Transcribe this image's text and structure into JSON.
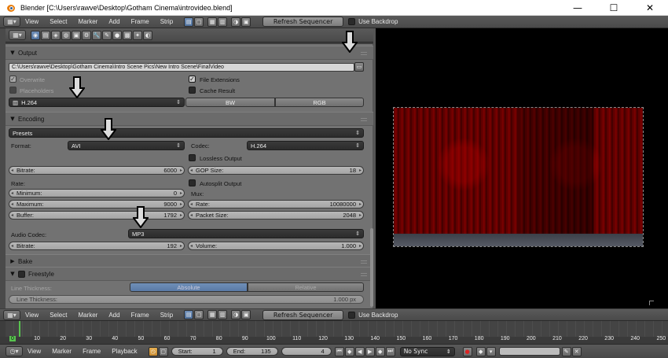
{
  "window": {
    "title": "Blender [C:\\Users\\rawve\\Desktop\\Gotham Cinema\\introvideo.blend]",
    "minimize": "—",
    "maximize": "☐",
    "close": "✕"
  },
  "header": {
    "menus": [
      "View",
      "Select",
      "Marker",
      "Add",
      "Frame",
      "Strip"
    ],
    "refresh_label": "Refresh Sequencer",
    "backdrop_label": "Use Backdrop"
  },
  "output": {
    "section_label": "Output",
    "path": "C:\\Users\\rawve\\Desktop\\Gotham Cinema\\Intro Scene Pics\\New Intro Scene\\FinalVideo",
    "overwrite_label": "Overwrite",
    "placeholders_label": "Placeholders",
    "file_extensions_label": "File Extensions",
    "cache_result_label": "Cache Result",
    "file_format": "H.264",
    "color_bw": "BW",
    "color_rgb": "RGB"
  },
  "encoding": {
    "section_label": "Encoding",
    "presets_label": "Presets",
    "format_label": "Format:",
    "format_value": "AVI",
    "codec_label": "Codec:",
    "codec_value": "H.264",
    "lossless_label": "Lossless Output",
    "bitrate_label": "Bitrate:",
    "bitrate_value": "6000",
    "gop_label": "GOP Size:",
    "gop_value": "18",
    "rate_label": "Rate:",
    "autosplit_label": "Autosplit Output",
    "minimum_label": "Minimum:",
    "minimum_value": "0",
    "mux_label": "Mux:",
    "maximum_label": "Maximum:",
    "maximum_value": "9000",
    "mux_rate_label": "Rate:",
    "mux_rate_value": "10080000",
    "buffer_label": "Buffer:",
    "buffer_value": "1792",
    "packet_label": "Packet Size:",
    "packet_value": "2048",
    "audio_codec_label": "Audio Codec:",
    "audio_codec_value": "MP3",
    "audio_bitrate_label": "Bitrate:",
    "audio_bitrate_value": "192",
    "volume_label": "Volume:",
    "volume_value": "1.000"
  },
  "bake": {
    "section_label": "Bake"
  },
  "freestyle": {
    "section_label": "Freestyle",
    "line_thickness_label": "Line Thickness:",
    "absolute_label": "Absolute",
    "relative_label": "Relative",
    "line_thickness_value_label": "Line Thickness:",
    "line_thickness_value": "1.000 px"
  },
  "timeline": {
    "ticks": [
      "0",
      "10",
      "20",
      "30",
      "40",
      "50",
      "60",
      "70",
      "80",
      "90",
      "100",
      "110",
      "120",
      "130",
      "140",
      "150",
      "160",
      "170",
      "180",
      "190",
      "200",
      "210",
      "220",
      "230",
      "240",
      "250"
    ],
    "current_frame": "0"
  },
  "statusbar": {
    "menus": [
      "View",
      "Marker",
      "Frame",
      "Playback"
    ],
    "start_label": "Start:",
    "start_value": "1",
    "end_label": "End:",
    "end_value": "135",
    "frame_value": "4",
    "sync_value": "No Sync"
  }
}
